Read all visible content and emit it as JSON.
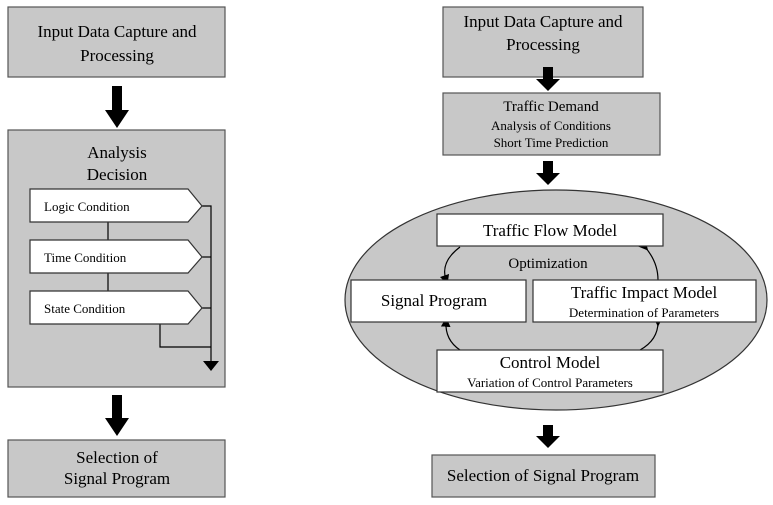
{
  "left": {
    "input_box": [
      "Input Data Capture and",
      "Processing"
    ],
    "analysis_box": {
      "title": [
        "Analysis",
        "Decision"
      ],
      "conditions": [
        "Logic Condition",
        "Time Condition",
        "State Condition"
      ]
    },
    "selection_box": [
      "Selection of",
      "Signal Program"
    ]
  },
  "right": {
    "input_box": [
      "Input Data Capture and",
      "Processing"
    ],
    "traffic_demand": {
      "title": "Traffic Demand",
      "lines": [
        "Analysis of Conditions",
        "Short Time Prediction"
      ]
    },
    "optimization": {
      "label": "Optimization",
      "traffic_flow_model": "Traffic Flow Model",
      "signal_program": "Signal Program",
      "traffic_impact_model": {
        "title": "Traffic Impact Model",
        "subtitle": "Determination of Parameters"
      },
      "control_model": {
        "title": "Control Model",
        "subtitle": "Variation of Control Parameters"
      }
    },
    "selection_box": "Selection of Signal Program"
  },
  "colors": {
    "box_fill": "#c8c8c8",
    "ellipse_fill": "#c8c8c8"
  }
}
